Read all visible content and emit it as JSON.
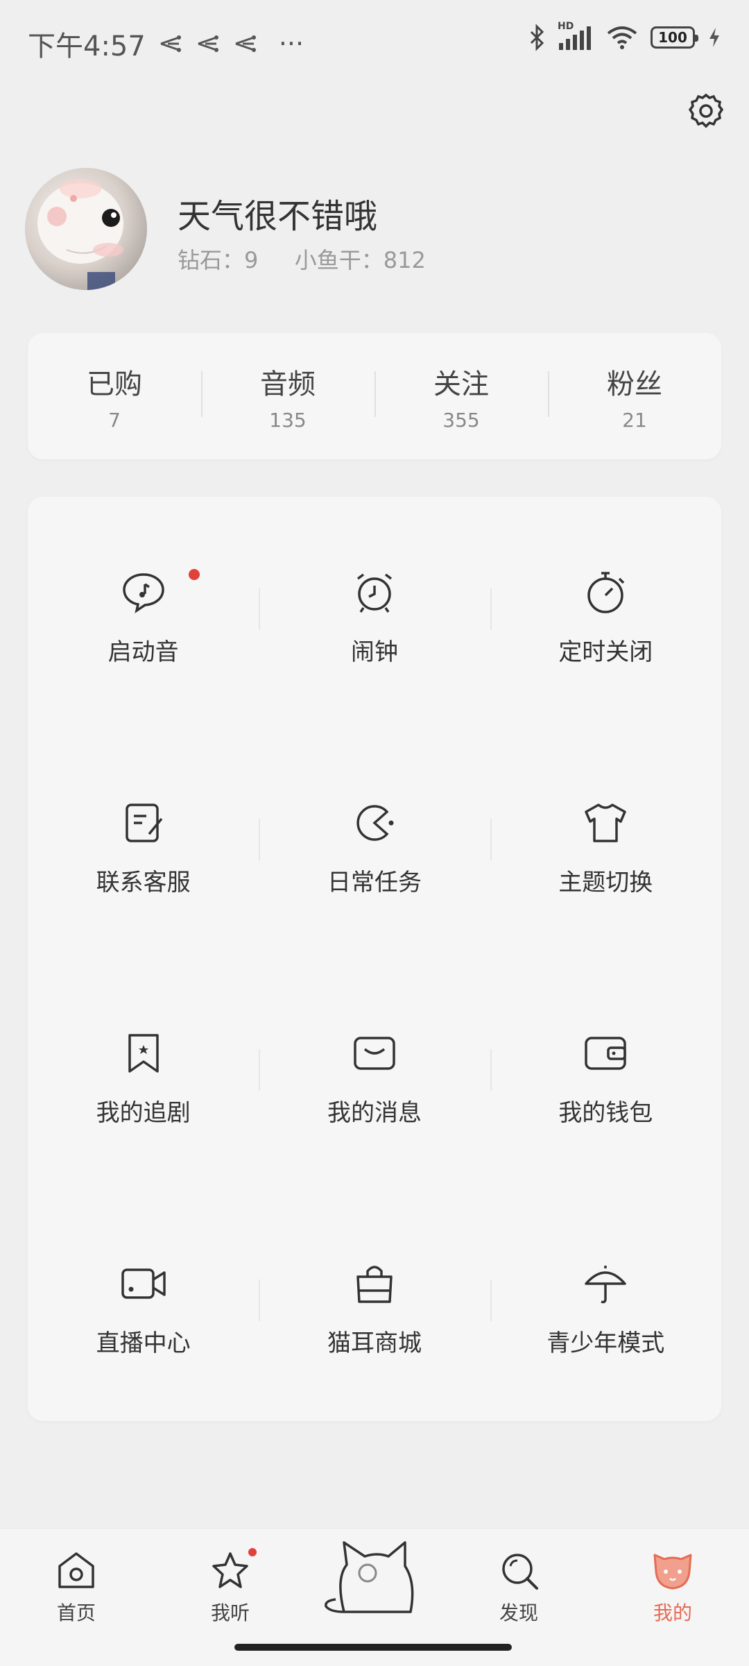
{
  "status": {
    "time": "下午4:57",
    "more": "···",
    "battery": "100",
    "network": "HD"
  },
  "profile": {
    "name": "天气很不错哦",
    "diamond_label": "钻石：9",
    "fish_label": "小鱼干：812"
  },
  "counts": [
    {
      "label": "已购",
      "value": "7"
    },
    {
      "label": "音频",
      "value": "135"
    },
    {
      "label": "关注",
      "value": "355"
    },
    {
      "label": "粉丝",
      "value": "21"
    }
  ],
  "grid": [
    {
      "label": "启动音",
      "icon": "speech-bubble-music-icon",
      "badge": true
    },
    {
      "label": "闹钟",
      "icon": "alarm-clock-icon"
    },
    {
      "label": "定时关闭",
      "icon": "stopwatch-icon"
    },
    {
      "label": "联系客服",
      "icon": "feedback-edit-icon"
    },
    {
      "label": "日常任务",
      "icon": "pacman-icon"
    },
    {
      "label": "主题切换",
      "icon": "tshirt-icon"
    },
    {
      "label": "我的追剧",
      "icon": "bookmark-icon"
    },
    {
      "label": "我的消息",
      "icon": "message-icon"
    },
    {
      "label": "我的钱包",
      "icon": "wallet-icon"
    },
    {
      "label": "直播中心",
      "icon": "video-camera-icon"
    },
    {
      "label": "猫耳商城",
      "icon": "shopping-bag-icon"
    },
    {
      "label": "青少年模式",
      "icon": "umbrella-icon"
    }
  ],
  "tabs": [
    {
      "label": "首页",
      "icon": "home-icon"
    },
    {
      "label": "我听",
      "icon": "star-icon",
      "badge": true
    },
    {
      "label": "",
      "icon": "cat-icon"
    },
    {
      "label": "发现",
      "icon": "search-icon"
    },
    {
      "label": "我的",
      "icon": "cat-face-icon",
      "active": true
    }
  ],
  "colors": {
    "accent": "#e56c55",
    "badge": "#e0413a",
    "background": "#efefef",
    "card": "#f6f6f6"
  }
}
